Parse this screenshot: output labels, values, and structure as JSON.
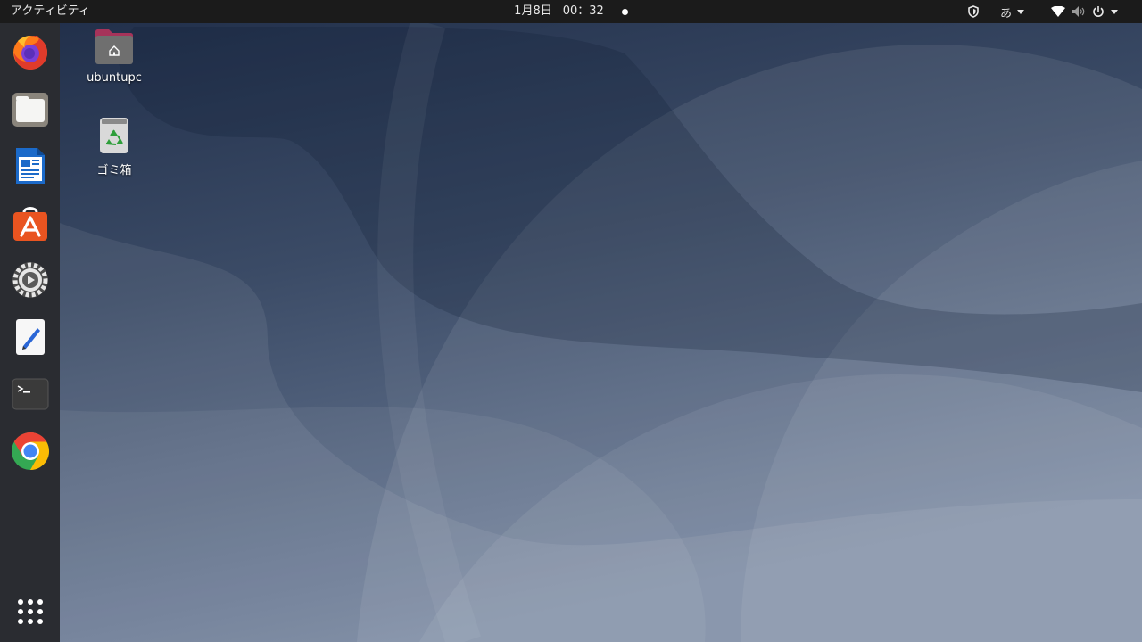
{
  "topbar": {
    "activities": "アクティビティ",
    "clock_date": "1月8日",
    "clock_time": "00：32",
    "input_method": "あ"
  },
  "dock": {
    "items": [
      {
        "name": "firefox",
        "icon": "firefox-icon"
      },
      {
        "name": "files",
        "icon": "files-icon"
      },
      {
        "name": "libreoffice-writer",
        "icon": "writer-icon"
      },
      {
        "name": "ubuntu-software",
        "icon": "software-icon"
      },
      {
        "name": "settings",
        "icon": "settings-icon"
      },
      {
        "name": "text-editor",
        "icon": "text-editor-icon"
      },
      {
        "name": "terminal",
        "icon": "terminal-icon"
      },
      {
        "name": "chrome",
        "icon": "chrome-icon"
      }
    ],
    "show_apps": "grid-icon"
  },
  "desktop": {
    "icons": [
      {
        "label": "ubuntupc",
        "icon": "home-folder-icon"
      },
      {
        "label": "ゴミ箱",
        "icon": "trash-icon"
      }
    ]
  },
  "colors": {
    "topbar": "#1b1b1b",
    "dock": "#2a2c31",
    "wallpaper_dark": "#1f2d48",
    "wallpaper_light": "#8a9ab4"
  }
}
